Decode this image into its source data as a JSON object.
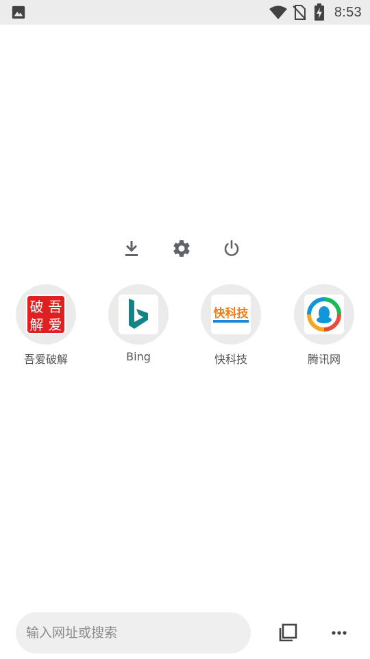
{
  "status_bar": {
    "time": "8:53",
    "icons": [
      "image-notification-icon",
      "wifi-icon",
      "no-sim-icon",
      "battery-charging-icon"
    ]
  },
  "quick_actions": [
    {
      "name": "download-icon"
    },
    {
      "name": "settings-gear-icon"
    },
    {
      "name": "power-icon"
    }
  ],
  "speed_dial": {
    "items": [
      {
        "label": "吾爱破解",
        "logo_chars": [
          "破",
          "吾",
          "解",
          "爱"
        ],
        "brand_color": "#e02020"
      },
      {
        "label": "Bing",
        "brand_color": "#138486"
      },
      {
        "label": "快科技",
        "logo_text": "快科技",
        "brand_colors": [
          "#f07f1a",
          "#1e88d8"
        ]
      },
      {
        "label": "腾讯网",
        "brand_colors": [
          "#1296db",
          "#f5a623",
          "#e94b3c",
          "#19b955"
        ]
      }
    ]
  },
  "bottom_bar": {
    "search_placeholder": "输入网址或搜索",
    "tabs_icon": "tabs-icon",
    "menu_icon": "more-horizontal-icon"
  }
}
